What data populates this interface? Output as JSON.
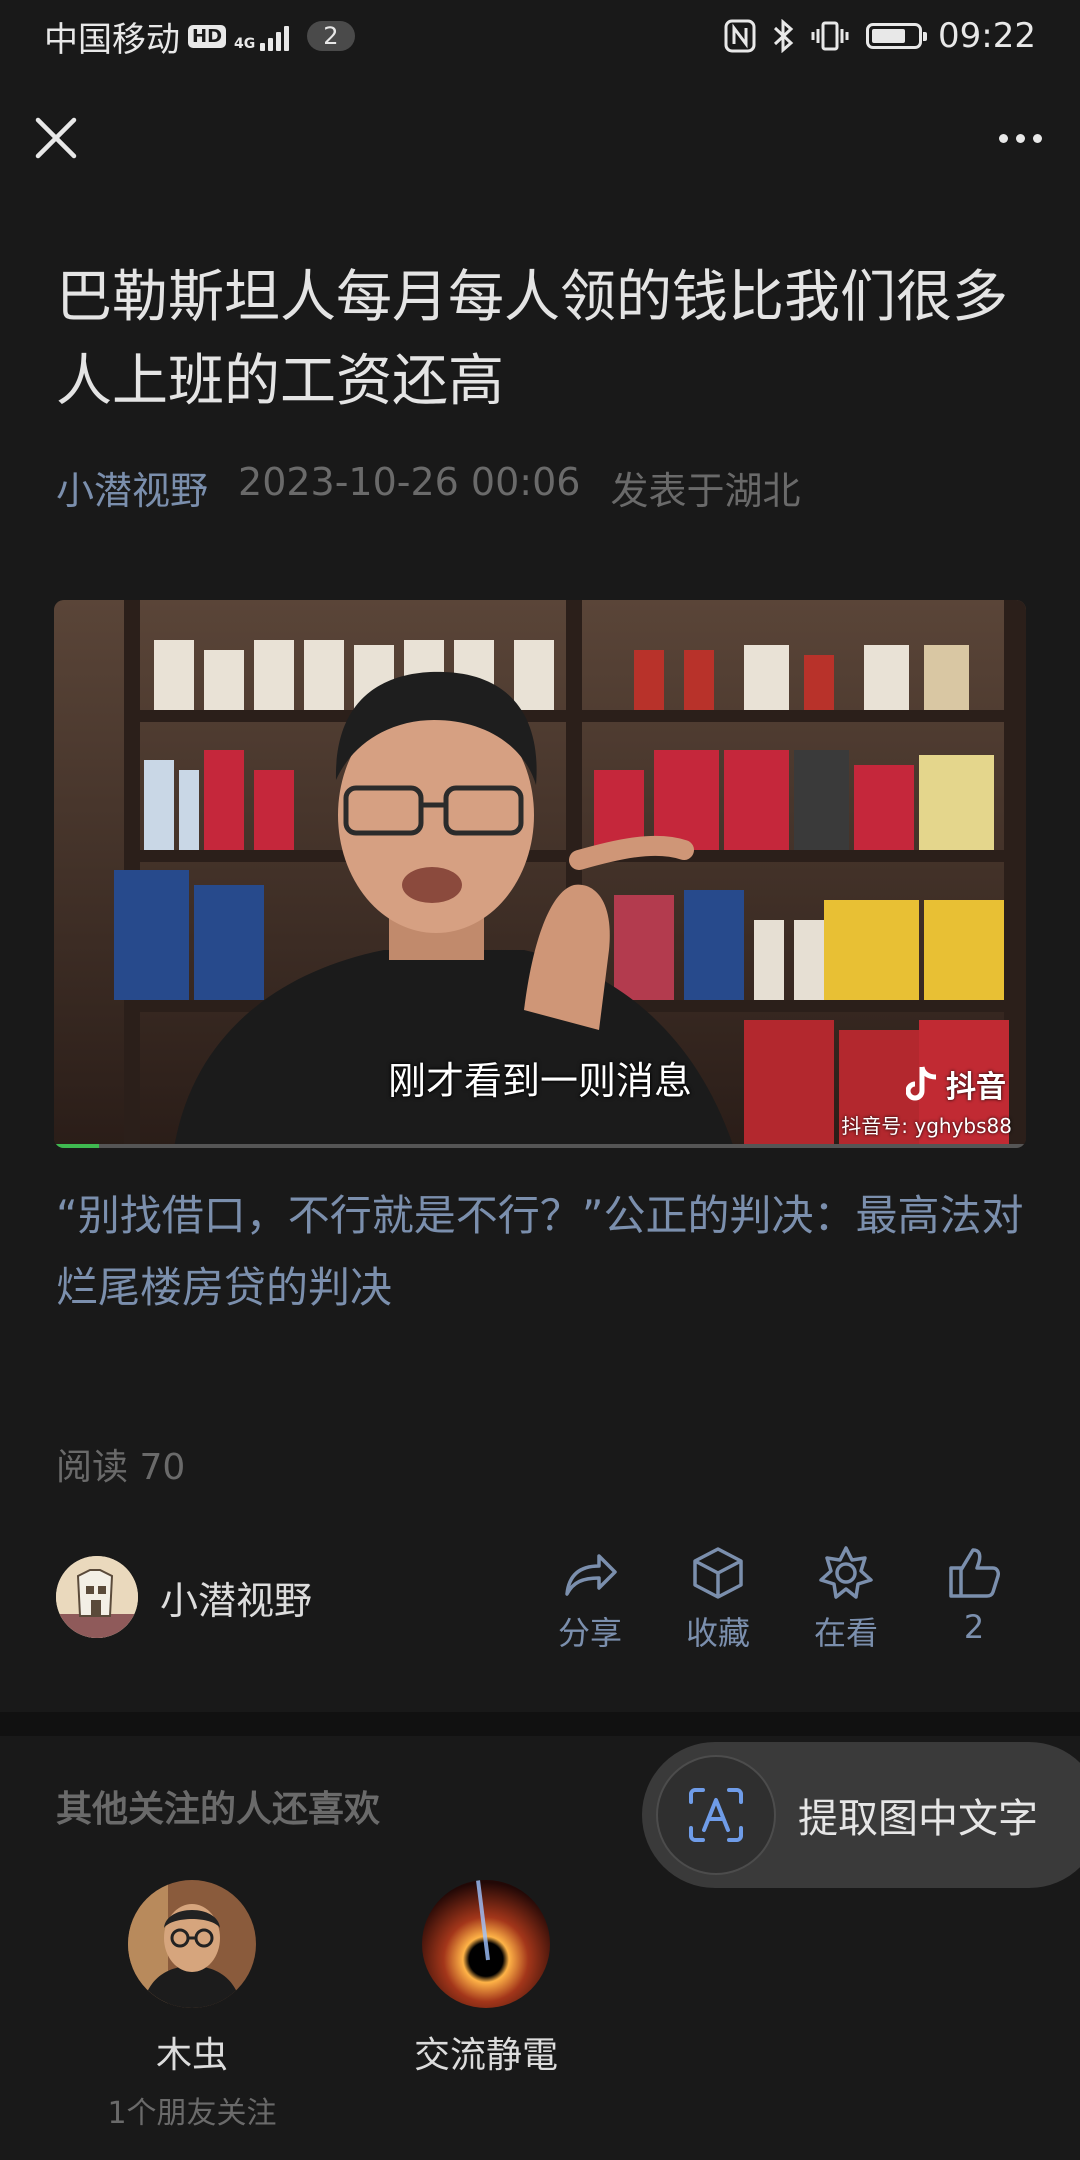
{
  "status_bar": {
    "carrier": "中国移动",
    "hd": "HD",
    "network": "4G",
    "notifications": "2",
    "time": "09:22",
    "battery_level": 0.75
  },
  "article": {
    "title": "巴勒斯坦人每月每人领的钱比我们很多人上班的工资还高",
    "author": "小潜视野",
    "date": "2023-10-26 00:06",
    "location": "发表于湖北",
    "video_subtitle": "刚才看到一则消息",
    "video_watermark": "抖音",
    "video_account": "抖音号: yghybs88",
    "body": "“别找借口，不行就是不行？”公正的判决：最高法对烂尾楼房贷的判决",
    "reads": "阅读 70"
  },
  "footer": {
    "author_name": "小潜视野",
    "actions": [
      {
        "label": "分享",
        "icon": "share-icon"
      },
      {
        "label": "收藏",
        "icon": "cube-icon"
      },
      {
        "label": "在看",
        "icon": "star-icon"
      },
      {
        "label": "2",
        "icon": "thumbs-up-icon"
      }
    ]
  },
  "recommend": {
    "title": "其他关注的人还喜欢",
    "users": [
      {
        "name": "木虫",
        "sub": "1个朋友关注"
      },
      {
        "name": "交流静電",
        "sub": ""
      }
    ]
  },
  "ocr_button": {
    "label": "提取图中文字"
  },
  "colors": {
    "background": "#191919",
    "accent": "#7b8fad",
    "muted": "#6a6a6a"
  }
}
